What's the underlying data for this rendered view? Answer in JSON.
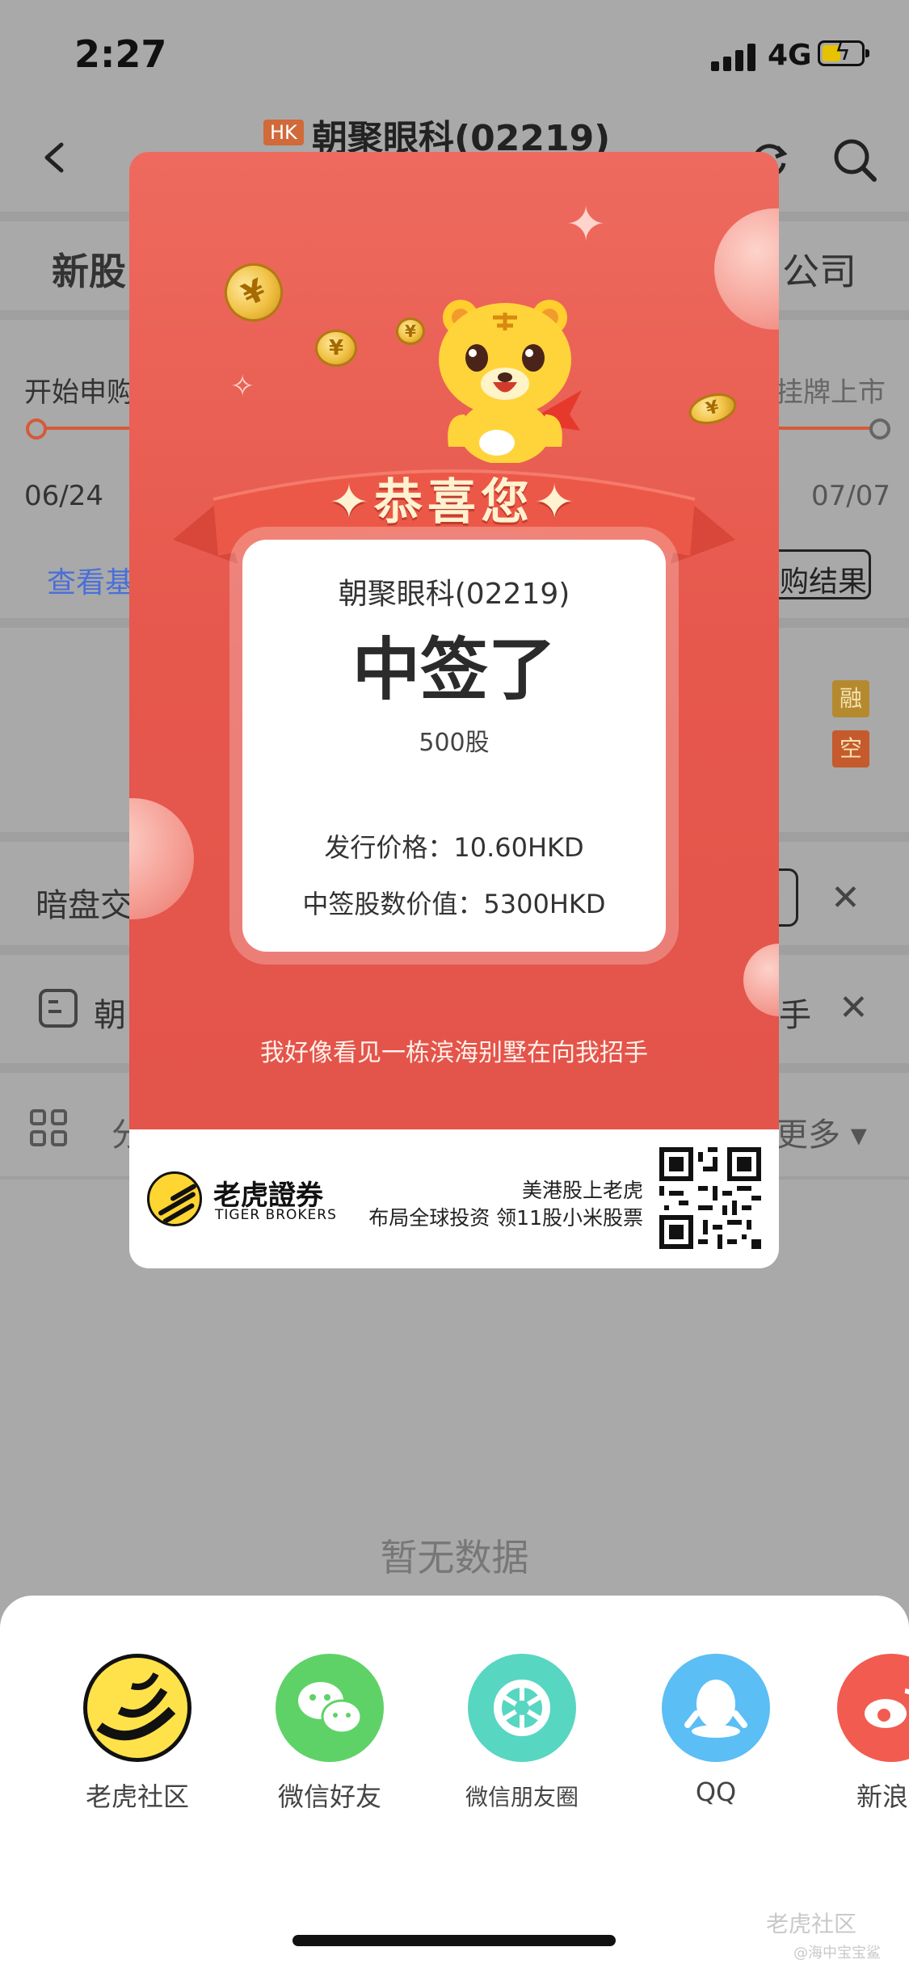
{
  "status": {
    "time": "2:27",
    "network": "4G"
  },
  "nav": {
    "market_badge": "HK",
    "title": "朝聚眼科(02219)"
  },
  "background": {
    "tab_left": "新股",
    "tab_right": "公司",
    "stage_start": "开始申购",
    "stage_end": "挂牌上市",
    "date_start": "06/24",
    "date_end": "07/07",
    "link_basic": "查看基",
    "result_button": "购结果",
    "tag_margin": "融",
    "tag_short": "空",
    "dark_pool": "暗盘交",
    "row_label": "朝",
    "row_label_right": "手",
    "row_label_bottom": "分",
    "more_label": "更多 ▾",
    "no_data": "暂无数据"
  },
  "card": {
    "banner_title": "✦恭喜您✦",
    "stock": "朝聚眼科(02219)",
    "headline": "中签了",
    "shares": "500股",
    "price_line": "发行价格：10.60HKD",
    "value_line": "中签股数价值：5300HKD",
    "slogan": "我好像看见一栋滨海别墅在向我招手",
    "brand_name": "老虎證券",
    "brand_en": "TIGER BROKERS",
    "ad_line1": "美港股上老虎",
    "ad_line2": "布局全球投资 领11股小米股票"
  },
  "share": {
    "items": [
      {
        "label": "老虎社区",
        "icon": "tiger-community-icon",
        "color": "#ffe24a"
      },
      {
        "label": "微信好友",
        "icon": "wechat-icon",
        "color": "#5fd267"
      },
      {
        "label": "微信朋友圈",
        "icon": "wechat-moments-icon",
        "color": "#57d6c2"
      },
      {
        "label": "QQ",
        "icon": "qq-icon",
        "color": "#5bbef5"
      },
      {
        "label": "新浪",
        "icon": "weibo-icon",
        "color": "#f25b4f"
      }
    ]
  },
  "watermark": {
    "main": "老虎社区",
    "sub": "@海中宝宝鲨"
  }
}
